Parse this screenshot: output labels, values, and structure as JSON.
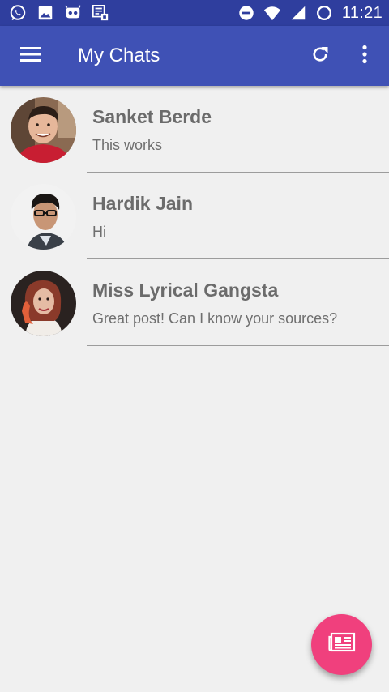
{
  "status_bar": {
    "time": "11:21",
    "left_icons": [
      "whatsapp-icon",
      "image-icon",
      "cyanogen-icon",
      "checklist-icon"
    ],
    "right_icons": [
      "do-not-disturb-icon",
      "wifi-icon",
      "signal-icon",
      "battery-icon"
    ]
  },
  "app_bar": {
    "title": "My Chats",
    "color": "#3f51b5",
    "status_color": "#2f3e9e"
  },
  "chats": [
    {
      "name": "Sanket Berde",
      "message": "This works"
    },
    {
      "name": "Hardik Jain",
      "message": "Hi"
    },
    {
      "name": "Miss Lyrical Gangsta",
      "message": "Great post!  Can I know your sources?"
    }
  ],
  "fab": {
    "icon": "newspaper-icon",
    "color": "#f0407d"
  }
}
